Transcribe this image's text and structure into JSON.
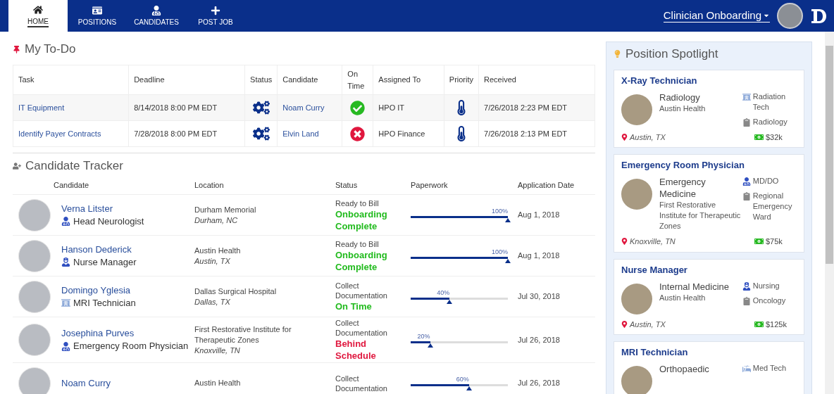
{
  "nav": {
    "tabs": [
      {
        "label": "HOME",
        "selected": true
      },
      {
        "label": "POSITIONS",
        "selected": false
      },
      {
        "label": "CANDIDATES",
        "selected": false
      },
      {
        "label": "POST JOB",
        "selected": false
      }
    ],
    "workspace": "Clinician Onboarding"
  },
  "todo": {
    "title": "My To-Do",
    "columns": [
      "Task",
      "Deadline",
      "Status",
      "Candidate",
      "On Time",
      "Assigned To",
      "Priority",
      "Received"
    ],
    "rows": [
      {
        "task": "IT Equipment",
        "deadline": "8/14/2018 8:00 PM EDT",
        "candidate": "Noam Curry",
        "on_time": true,
        "assigned_to": "HPO IT",
        "received": "7/26/2018 2:23 PM EDT"
      },
      {
        "task": "Identify Payer Contracts",
        "deadline": "7/28/2018 8:00 PM EDT",
        "candidate": "Elvin Land",
        "on_time": false,
        "assigned_to": "HPO Finance",
        "received": "7/26/2018 2:13 PM EDT"
      }
    ]
  },
  "tracker": {
    "title": "Candidate Tracker",
    "columns": [
      "Candidate",
      "Location",
      "Status",
      "Paperwork",
      "Application Date"
    ],
    "rows": [
      {
        "name": "Verna Litster",
        "role": "Head Neurologist",
        "kind": "doctor",
        "facility": "Durham Memorial",
        "city": "Durham, NC",
        "stage": "Ready to Bill",
        "status": "Onboarding Complete",
        "color": "#22bb1e",
        "level": 1,
        "reading": "100%",
        "date": "Aug 1, 2018"
      },
      {
        "name": "Hanson Dederick",
        "role": "Nurse Manager",
        "kind": "nurse",
        "facility": "Austin Health",
        "city": "Austin, TX",
        "stage": "Ready to Bill",
        "status": "Onboarding Complete",
        "color": "#22bb1e",
        "level": 1,
        "reading": "100%",
        "date": "Aug 1, 2018"
      },
      {
        "name": "Domingo Yglesia",
        "role": "MRI Technician",
        "kind": "tech",
        "facility": "Dallas Surgical Hospital",
        "city": "Dallas, TX",
        "stage": "Collect Documentation",
        "status": "On Time",
        "color": "#22bb1e",
        "level": 0.4,
        "reading": "40%",
        "date": "Jul 30, 2018"
      },
      {
        "name": "Josephina Purves",
        "role": "Emergency Room Physician",
        "kind": "doctor",
        "facility": "First Restorative Institute for Therapeutic Zones",
        "city": "Knoxville, TN",
        "stage": "Collect Documentation",
        "status": "Behind Schedule",
        "color": "#e0173e",
        "level": 0.2,
        "reading": "20%",
        "date": "Jul 26, 2018"
      },
      {
        "name": "Noam Curry",
        "facility": "Austin Health",
        "stage": "Collect Documentation",
        "level": 0.6,
        "reading": "60%",
        "date": "Jul 26, 2018"
      }
    ]
  },
  "spotlight": {
    "title": "Position Spotlight",
    "cards": [
      {
        "title": "X-Ray Technician",
        "specialty": "Radiology",
        "facility": "Austin Health",
        "city": "Austin, TX",
        "tags": [
          {
            "kind": "tech",
            "text": "Radiation Tech"
          },
          {
            "kind": "department",
            "text": "Radiology"
          }
        ],
        "salary": "$32k"
      },
      {
        "title": "Emergency Room Physician",
        "specialty": "Emergency Medicine",
        "facility": "First Restorative Institute for Therapeutic Zones",
        "city": "Knoxville, TN",
        "tags": [
          {
            "kind": "doctor",
            "text": "MD/DO"
          },
          {
            "kind": "department",
            "text": "Regional Emergency Ward"
          }
        ],
        "salary": "$75k"
      },
      {
        "title": "Nurse Manager",
        "specialty": "Internal Medicine",
        "facility": "Austin Health",
        "city": "Austin, TX",
        "tags": [
          {
            "kind": "nurse",
            "text": "Nursing"
          },
          {
            "kind": "department",
            "text": "Oncology"
          }
        ],
        "salary": "$125k"
      },
      {
        "title": "MRI Technician",
        "specialty": "Orthopaedic",
        "tags": [
          {
            "kind": "scan",
            "text": "Med Tech"
          }
        ]
      }
    ]
  }
}
